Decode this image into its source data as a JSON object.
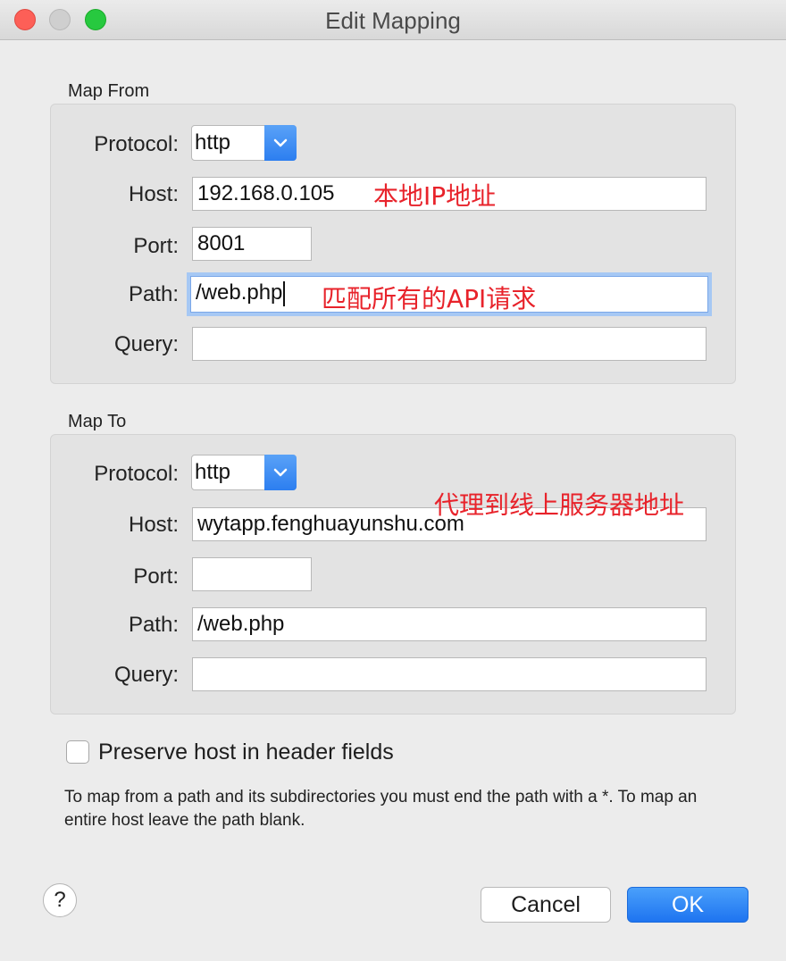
{
  "window": {
    "title": "Edit Mapping"
  },
  "map_from": {
    "label": "Map From",
    "protocol_label": "Protocol:",
    "protocol_value": "http",
    "host_label": "Host:",
    "host_value": "192.168.0.105",
    "port_label": "Port:",
    "port_value": "8001",
    "path_label": "Path:",
    "path_value": "/web.php",
    "query_label": "Query:",
    "query_value": ""
  },
  "map_to": {
    "label": "Map To",
    "protocol_label": "Protocol:",
    "protocol_value": "http",
    "host_label": "Host:",
    "host_value": "wytapp.fenghuayunshu.com",
    "port_label": "Port:",
    "port_value": "",
    "path_label": "Path:",
    "path_value": "/web.php",
    "query_label": "Query:",
    "query_value": ""
  },
  "annotations": {
    "from_host": "本地IP地址",
    "from_path": "匹配所有的API请求",
    "to_host": "代理到线上服务器地址"
  },
  "preserve_host": {
    "label": "Preserve host in header fields",
    "checked": false
  },
  "help_text": "To map from a path and its subdirectories you must end the path with a *. To map an entire host leave the path blank.",
  "buttons": {
    "help": "?",
    "cancel": "Cancel",
    "ok": "OK"
  },
  "colors": {
    "annotation": "#e8232b",
    "accent": "#2c7ef0",
    "focus_ring": "#a6c8f4"
  }
}
